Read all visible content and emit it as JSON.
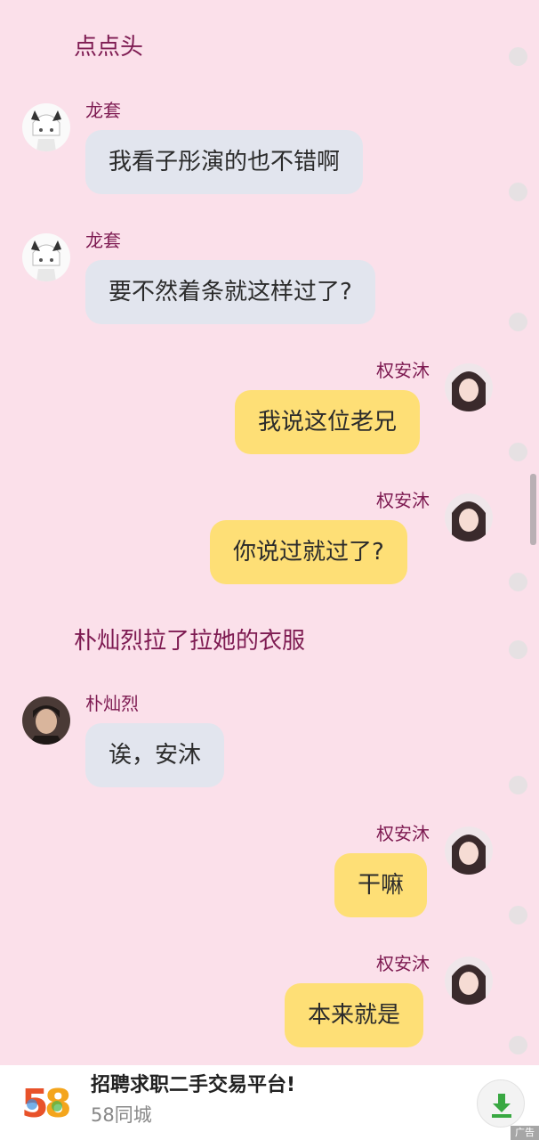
{
  "messages": {
    "n1": "点点头",
    "m1": {
      "name": "龙套",
      "text": "我看子彤演的也不错啊"
    },
    "m2": {
      "name": "龙套",
      "text": "要不然着条就这样过了?"
    },
    "m3": {
      "name": "权安沐",
      "text": "我说这位老兄"
    },
    "m4": {
      "name": "权安沐",
      "text": "你说过就过了?"
    },
    "n2": "朴灿烈拉了拉她的衣服",
    "m5": {
      "name": "朴灿烈",
      "text": "诶，安沐"
    },
    "m6": {
      "name": "权安沐",
      "text": "干嘛"
    },
    "m7": {
      "name": "权安沐",
      "text": "本来就是"
    }
  },
  "ad": {
    "logo_text": "58",
    "title": "招聘求职二手交易平台!",
    "subtitle": "58同城",
    "tag": "广告",
    "download_icon": "download-icon"
  },
  "colors": {
    "background": "#fbe0ea",
    "name": "#7e1b52",
    "left_bubble": "#e2e5ee",
    "right_bubble": "#fedf76"
  }
}
